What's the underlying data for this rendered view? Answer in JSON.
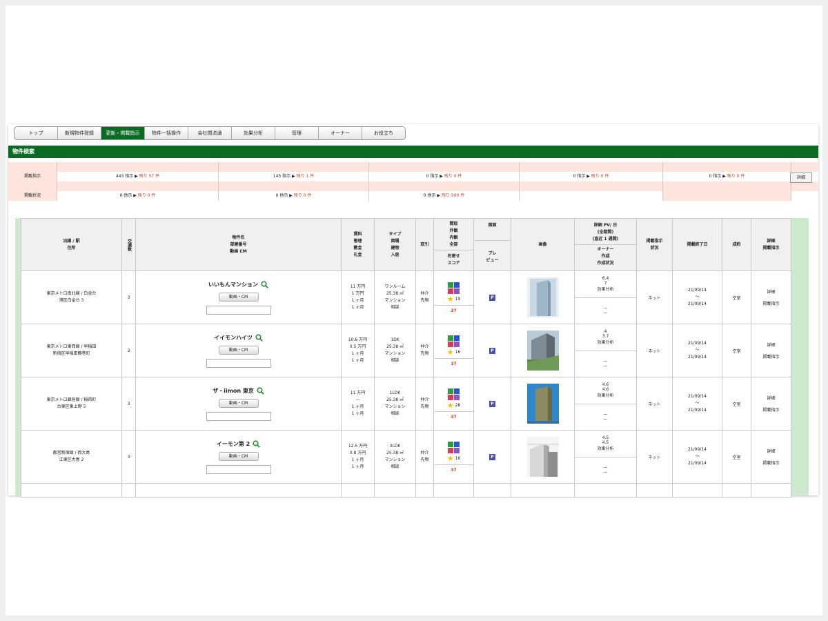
{
  "nav": {
    "tabs": [
      {
        "label": "トップ",
        "w": 62
      },
      {
        "label": "新規物件登録",
        "w": 62
      },
      {
        "label": "更新・掲載指示",
        "w": 62,
        "active": true
      },
      {
        "label": "物件一括操作",
        "w": 62
      },
      {
        "label": "会社間流通",
        "w": 62
      },
      {
        "label": "効果分析",
        "w": 62
      },
      {
        "label": "管理",
        "w": 62
      },
      {
        "label": "オーナー",
        "w": 62
      },
      {
        "label": "お役立ち",
        "w": 62
      }
    ]
  },
  "page_title": "物件検索",
  "status": {
    "row1_label": "掲載指示",
    "row1_cells": [
      {
        "count": "443 指示 ▶",
        "remain": "残り 57 件"
      },
      {
        "count": "145 指示 ▶",
        "remain": "残り 1 件"
      },
      {
        "count": "0 指示 ▶",
        "remain": "残り 0 件"
      },
      {
        "count": "0 指示 ▶",
        "remain": "残り 0 件"
      },
      {
        "count": "0 指示 ▶",
        "remain": "残り 0 件"
      }
    ],
    "detail_label": "詳細",
    "row2_label": "掲載状況",
    "row2_cells": [
      {
        "count": "0 他示 ▶",
        "remain": "残り 0 件"
      },
      {
        "count": "0 他示 ▶",
        "remain": "残り 0 件"
      },
      {
        "count": "0 他示 ▶",
        "remain": "残り 500 件"
      }
    ]
  },
  "table": {
    "headers": {
      "route": [
        "沿線 / 駅",
        "住所"
      ],
      "transport": "交通数",
      "name": [
        "物件名",
        "部屋番号",
        "動画 CM"
      ],
      "fees": [
        "賃料",
        "管理",
        "敷金",
        "礼金"
      ],
      "type": [
        "タイプ",
        "面積",
        "建物",
        "入居"
      ],
      "deal": "取引",
      "score_top": [
        "間取",
        "外観",
        "内観",
        "全部"
      ],
      "score_bot": [
        "名寄せ",
        "スコア"
      ],
      "plan_top": "図面",
      "plan_bot": [
        "プレ",
        "ビュー"
      ],
      "image": "画像",
      "pv_top": [
        "詳細 PV/ 日",
        "(全期間)",
        "(直近 1 週間)"
      ],
      "pv_bot": [
        "オーナー",
        "作成",
        "作成状況"
      ],
      "instruct": [
        "掲載指示",
        "状況"
      ],
      "enddate": "掲載終了日",
      "contract": "成約",
      "detail": [
        "詳細",
        "掲載指示"
      ]
    },
    "rows": [
      {
        "route": [
          "東京メトロ南北線 / 白金台",
          "港区白金台 3"
        ],
        "transport": "3",
        "name": "いいもんマンション",
        "cm": "動画・CM",
        "fees": [
          "11 万円",
          "1 万円",
          "1 ヶ月",
          "1 ヶ月"
        ],
        "type": [
          "ワンルーム",
          "25.38 ㎡",
          "マンション",
          "相談"
        ],
        "deal": [
          "仲介",
          "先物"
        ],
        "star_count": "19",
        "score": "37",
        "pv": [
          "6.4",
          "7",
          "効果分析"
        ],
        "owner": [
          "—",
          "—"
        ],
        "instruct": "ネット",
        "dates": [
          "21/09/14",
          "〜",
          "21/09/14"
        ],
        "contract": "空室",
        "detail": [
          "詳細",
          "掲載指示"
        ],
        "img": "a"
      },
      {
        "route": [
          "東京メトロ東西線 / 早稲田",
          "新宿区早稲田鶴巻町"
        ],
        "transport": "3",
        "name": "イイモンハイツ",
        "cm": "動画・CM",
        "fees": [
          "10.6 万円",
          "0.5 万円",
          "1 ヶ月",
          "1 ヶ月"
        ],
        "type": [
          "1DK",
          "25.38 ㎡",
          "マンション",
          "相談"
        ],
        "deal": [
          "仲介",
          "先物"
        ],
        "star_count": "16",
        "score": "37",
        "pv": [
          "4",
          "3.7",
          "効果分析"
        ],
        "owner": [
          "—",
          "—"
        ],
        "instruct": "ネット",
        "dates": [
          "21/09/14",
          "〜",
          "21/09/14"
        ],
        "contract": "空室",
        "detail": [
          "詳細",
          "掲載指示"
        ],
        "img": "b"
      },
      {
        "route": [
          "東京メトロ銀座線 / 稲荷町",
          "台東区東上野 5"
        ],
        "transport": "3",
        "name": "ザ・iimon 東京",
        "cm": "動画・CM",
        "fees": [
          "11 万円",
          "—",
          "1 ヶ月",
          "1 ヶ月"
        ],
        "type": [
          "1LDK",
          "25.38 ㎡",
          "マンション",
          "相談"
        ],
        "deal": [
          "仲介",
          "先物"
        ],
        "star_count": "28",
        "score": "37",
        "pv": [
          "4.6",
          "4.6",
          "効果分析"
        ],
        "owner": [
          "—",
          "—"
        ],
        "instruct": "ネット",
        "dates": [
          "21/09/14",
          "〜",
          "21/09/14"
        ],
        "contract": "空室",
        "detail": [
          "詳細",
          "掲載指示"
        ],
        "img": "c"
      },
      {
        "route": [
          "都営新宿線 / 西大島",
          "江東区大島 2"
        ],
        "transport": "3",
        "name": "イーモン第 2",
        "cm": "動画・CM",
        "fees": [
          "12.5 万円",
          "0.8 万円",
          "1 ヶ月",
          "1 ヶ月"
        ],
        "type": [
          "3LDK",
          "25.38 ㎡",
          "マンション",
          "相談"
        ],
        "deal": [
          "仲介",
          "先物"
        ],
        "star_count": "16",
        "score": "37",
        "pv": [
          "4.5",
          "4.5",
          "効果分析"
        ],
        "owner": [
          "—",
          "—"
        ],
        "instruct": "ネット",
        "dates": [
          "21/09/14",
          "〜",
          "21/09/14"
        ],
        "contract": "空室",
        "detail": [
          "詳細",
          "掲載指示"
        ],
        "img": "d"
      }
    ]
  },
  "colors": {
    "accent_green": "#0b6b22",
    "pink": "#fde4dc",
    "red": "#d23a1a",
    "side_green": "#cfe9cf"
  }
}
